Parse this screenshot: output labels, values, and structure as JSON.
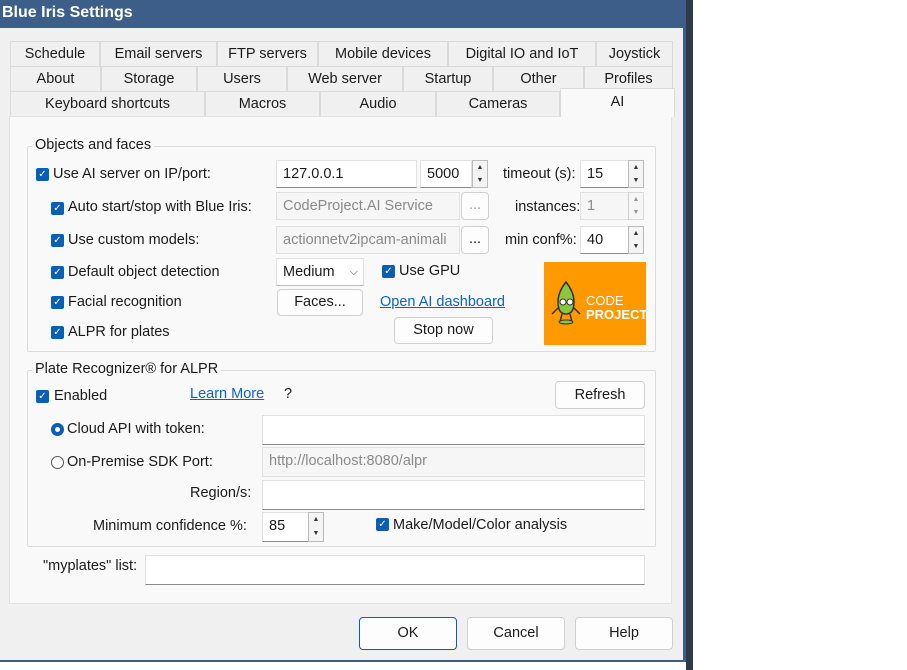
{
  "window": {
    "title": "Blue Iris Settings"
  },
  "tabs": {
    "row1": [
      "Schedule",
      "Email servers",
      "FTP servers",
      "Mobile devices",
      "Digital IO and IoT",
      "Joystick"
    ],
    "row2": [
      "About",
      "Storage",
      "Users",
      "Web server",
      "Startup",
      "Other",
      "Profiles"
    ],
    "row3": [
      "Keyboard shortcuts",
      "Macros",
      "Audio",
      "Cameras",
      "AI"
    ],
    "selected": "AI"
  },
  "objects": {
    "title": "Objects and faces",
    "use_ai_server": {
      "label": "Use AI server on IP/port:",
      "checked": true
    },
    "ip": "127.0.0.1",
    "port": "5000",
    "timeout_label": "timeout (s):",
    "timeout": "15",
    "auto_start": {
      "label": "Auto start/stop with Blue Iris:",
      "checked": true
    },
    "service": "CodeProject.AI Service",
    "browse": "...",
    "instances_label": "instances:",
    "instances": "1",
    "custom_models": {
      "label": "Use custom models:",
      "checked": true
    },
    "models": "actionnetv2ipcam-animali",
    "min_conf_label": "min conf%:",
    "min_conf": "40",
    "default_detection": {
      "label": "Default object detection",
      "checked": true
    },
    "detection_mode": "Medium",
    "use_gpu": {
      "label": "Use GPU",
      "checked": true
    },
    "facial": {
      "label": "Facial recognition",
      "checked": true
    },
    "faces_button": "Faces...",
    "dashboard_link": "Open AI dashboard",
    "alpr": {
      "label": "ALPR for plates",
      "checked": true
    },
    "stop_button": "Stop now",
    "logo": {
      "text": "CODE PROJECT",
      "color": "#ff9900"
    }
  },
  "plate": {
    "title": "Plate Recognizer® for ALPR",
    "enabled": {
      "label": "Enabled",
      "checked": true
    },
    "learn_more": "Learn More",
    "help_q": "?",
    "refresh": "Refresh",
    "cloud": {
      "label": "Cloud API with token:",
      "selected": true
    },
    "onprem": {
      "label": "On-Premise SDK Port:",
      "selected": false
    },
    "onprem_value": "http://localhost:8080/alpr",
    "region_label": "Region/s:",
    "region": "",
    "min_conf_label": "Minimum confidence %:",
    "min_conf": "85",
    "mmc": {
      "label": "Make/Model/Color analysis",
      "checked": true
    }
  },
  "myplates": {
    "label": "\"myplates\" list:",
    "value": ""
  },
  "buttons": {
    "ok": "OK",
    "cancel": "Cancel",
    "help": "Help"
  }
}
